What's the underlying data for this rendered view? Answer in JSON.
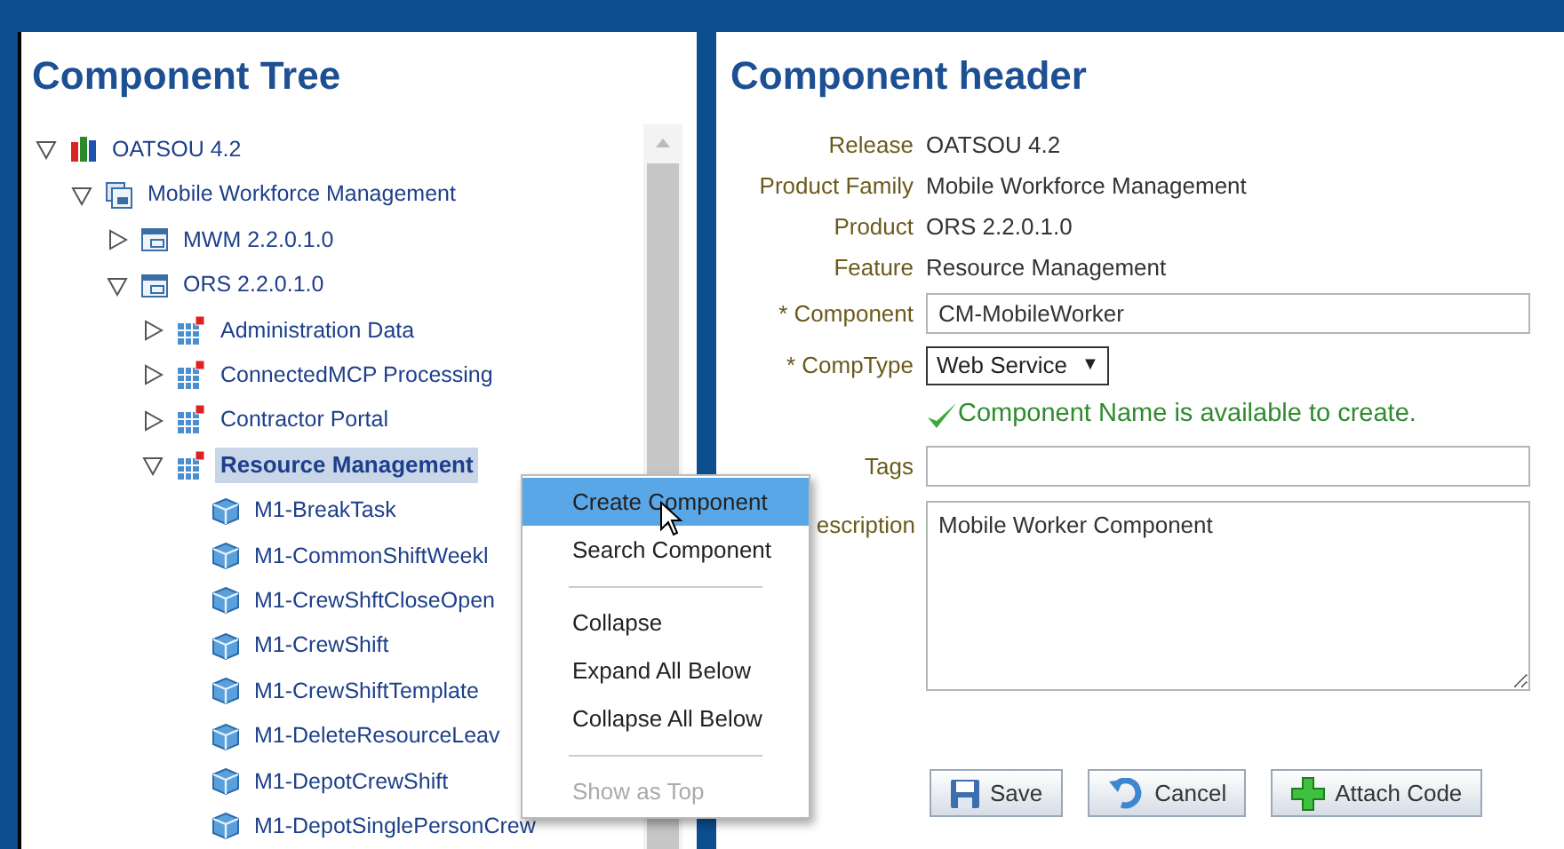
{
  "tree_panel": {
    "title": "Component Tree",
    "tree": [
      {
        "label": "OATSOU 4.2",
        "kind": "release",
        "expanded": true,
        "selected": false,
        "children": [
          {
            "label": "Mobile Workforce Management",
            "kind": "family",
            "expanded": true,
            "selected": false,
            "children": [
              {
                "label": "MWM 2.2.0.1.0",
                "kind": "product",
                "expanded": false,
                "selected": false
              },
              {
                "label": "ORS 2.2.0.1.0",
                "kind": "product",
                "expanded": true,
                "selected": false,
                "children": [
                  {
                    "label": "Administration Data",
                    "kind": "feature",
                    "expanded": false,
                    "selected": false
                  },
                  {
                    "label": "ConnectedMCP Processing",
                    "kind": "feature",
                    "expanded": false,
                    "selected": false
                  },
                  {
                    "label": "Contractor Portal",
                    "kind": "feature",
                    "expanded": false,
                    "selected": false
                  },
                  {
                    "label": "Resource Management",
                    "kind": "feature",
                    "expanded": true,
                    "selected": true,
                    "children": [
                      {
                        "label": "M1-BreakTask",
                        "kind": "component",
                        "selected": false
                      },
                      {
                        "label": "M1-CommonShiftWeekl",
                        "kind": "component",
                        "selected": false
                      },
                      {
                        "label": "M1-CrewShftCloseOpen",
                        "kind": "component",
                        "selected": false
                      },
                      {
                        "label": "M1-CrewShift",
                        "kind": "component",
                        "selected": false
                      },
                      {
                        "label": "M1-CrewShiftTemplate",
                        "kind": "component",
                        "selected": false
                      },
                      {
                        "label": "M1-DeleteResourceLeav",
                        "kind": "component",
                        "selected": false
                      },
                      {
                        "label": "M1-DepotCrewShift",
                        "kind": "component",
                        "selected": false
                      },
                      {
                        "label": "M1-DepotSinglePersonCrew",
                        "kind": "component",
                        "selected": false
                      }
                    ]
                  }
                ]
              }
            ]
          }
        ]
      }
    ]
  },
  "context_menu": {
    "items": [
      {
        "kind": "item",
        "label": "Create Component",
        "selected": true,
        "disabled": false
      },
      {
        "kind": "item",
        "label": "Search Component",
        "selected": false,
        "disabled": false
      },
      {
        "kind": "separator"
      },
      {
        "kind": "item",
        "label": "Collapse",
        "selected": false,
        "disabled": false
      },
      {
        "kind": "item",
        "label": "Expand All Below",
        "selected": false,
        "disabled": false
      },
      {
        "kind": "item",
        "label": "Collapse All Below",
        "selected": false,
        "disabled": false
      },
      {
        "kind": "separator"
      },
      {
        "kind": "item",
        "label": "Show as Top",
        "selected": false,
        "disabled": true
      }
    ]
  },
  "header_panel": {
    "title": "Component header",
    "fields": [
      {
        "kind": "text",
        "label": "Release",
        "value": "OATSOU 4.2"
      },
      {
        "kind": "text",
        "label": "Product Family",
        "value": "Mobile Workforce Management"
      },
      {
        "kind": "text",
        "label": "Product",
        "value": "ORS 2.2.0.1.0"
      },
      {
        "kind": "text",
        "label": "Feature",
        "value": "Resource Management"
      },
      {
        "kind": "input",
        "label": "* Component",
        "value": "CM-MobileWorker"
      },
      {
        "kind": "select",
        "label": "* CompType",
        "value": "Web Service",
        "arrow": "▼"
      },
      {
        "kind": "message",
        "value": "Component Name is available to create."
      },
      {
        "kind": "input",
        "label": "Tags"
      },
      {
        "kind": "textarea",
        "label": "escription",
        "value": "Mobile Worker Component"
      }
    ],
    "buttons": [
      {
        "kind": "save",
        "label": "Save"
      },
      {
        "kind": "cancel",
        "label": "Cancel"
      },
      {
        "kind": "attach",
        "label": "Attach Code"
      }
    ]
  }
}
